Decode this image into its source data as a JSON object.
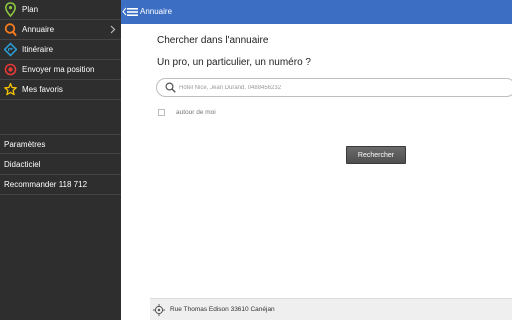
{
  "drawer": {
    "items": [
      {
        "label": "Plan",
        "icon": "map-pin-icon",
        "color": "#8cc63f"
      },
      {
        "label": "Annuaire",
        "icon": "search-icon",
        "color": "#f47b20",
        "has_chevron": true
      },
      {
        "label": "Itinéraire",
        "icon": "directions-icon",
        "color": "#2a9fd8"
      },
      {
        "label": "Envoyer ma position",
        "icon": "target-icon",
        "color": "#e53935"
      },
      {
        "label": "Mes favoris",
        "icon": "star-icon",
        "color": "#f5c400"
      }
    ],
    "secondary": [
      {
        "label": "Paramètres"
      },
      {
        "label": "Didacticiel"
      },
      {
        "label": "Recommander 118 712"
      }
    ]
  },
  "header": {
    "title": "Annuaire",
    "background": "#3c6fc4"
  },
  "main": {
    "title": "Chercher dans l'annuaire",
    "subtitle": "Un pro, un particulier, un numéro ?",
    "search_placeholder": "Hôtel Nice, Jean Durand, 0488456232",
    "search_value": "",
    "checkbox_label": "autour de moi",
    "checkbox_checked": false,
    "search_button_label": "Rechercher"
  },
  "location": {
    "address": "Rue Thomas Edison 33610 Canéjan",
    "icon": "gps-icon"
  }
}
